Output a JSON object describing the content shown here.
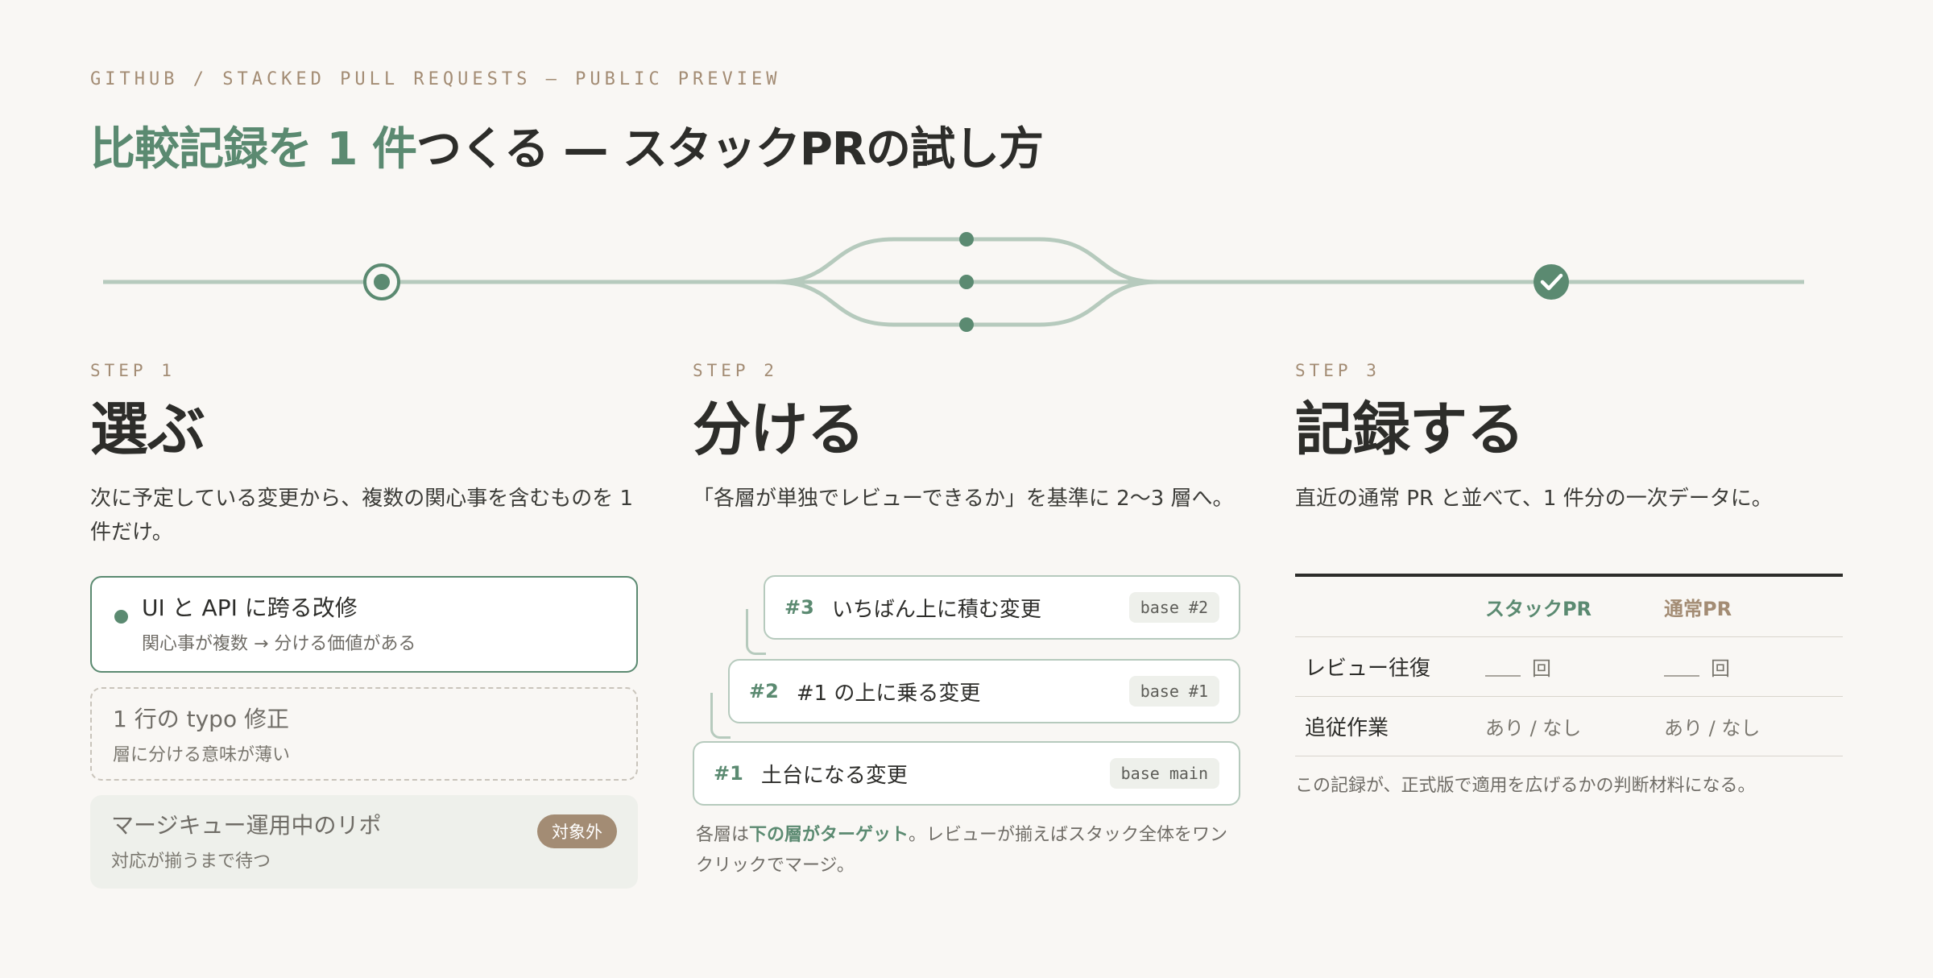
{
  "header": {
    "eyebrow": "GITHUB / STACKED PULL REQUESTS — PUBLIC PREVIEW",
    "title_accent": "比較記録を 1 件",
    "title_rest": "つくる — スタックPRの試し方"
  },
  "colors": {
    "accent_green": "#5b8a71",
    "accent_tan": "#a38c74",
    "line_green": "#b6cabd",
    "background": "#f9f7f4"
  },
  "steps": [
    {
      "label": "STEP 1",
      "title": "選ぶ",
      "desc": "次に予定している変更から、複数の関心事を含むものを 1 件だけ。"
    },
    {
      "label": "STEP 2",
      "title": "分ける",
      "desc": "「各層が単独でレビューできるか」を基準に 2〜3 層へ。"
    },
    {
      "label": "STEP 3",
      "title": "記録する",
      "desc": "直近の通常 PR と並べて、1 件分の一次データに。"
    }
  ],
  "options": {
    "selected": {
      "title": "UI と API に跨る改修",
      "sub": "関心事が複数 → 分ける価値がある"
    },
    "weak": {
      "title": "1 行の typo 修正",
      "sub": "層に分ける意味が薄い"
    },
    "excluded": {
      "title": "マージキュー運用中のリポ",
      "sub": "対応が揃うまで待つ",
      "badge": "対象外"
    }
  },
  "stack": {
    "prs": [
      {
        "num": "#3",
        "label": "いちばん上に積む変更",
        "base": "base #2"
      },
      {
        "num": "#2",
        "label": "#1 の上に乗る変更",
        "base": "base #1"
      },
      {
        "num": "#1",
        "label": "土台になる変更",
        "base": "base main"
      }
    ],
    "note_prefix": "各層は",
    "note_emphasis": "下の層がターゲット",
    "note_suffix": "。レビューが揃えばスタック全体をワンクリックでマージ。"
  },
  "record_table": {
    "col_stack": "スタックPR",
    "col_normal": "通常PR",
    "rows": [
      {
        "label": "レビュー往復",
        "stack": "回",
        "normal": "回"
      },
      {
        "label": "追従作業",
        "stack": "あり / なし",
        "normal": "あり / なし"
      }
    ],
    "footnote": "この記録が、正式版で適用を広げるかの判断材料になる。"
  }
}
